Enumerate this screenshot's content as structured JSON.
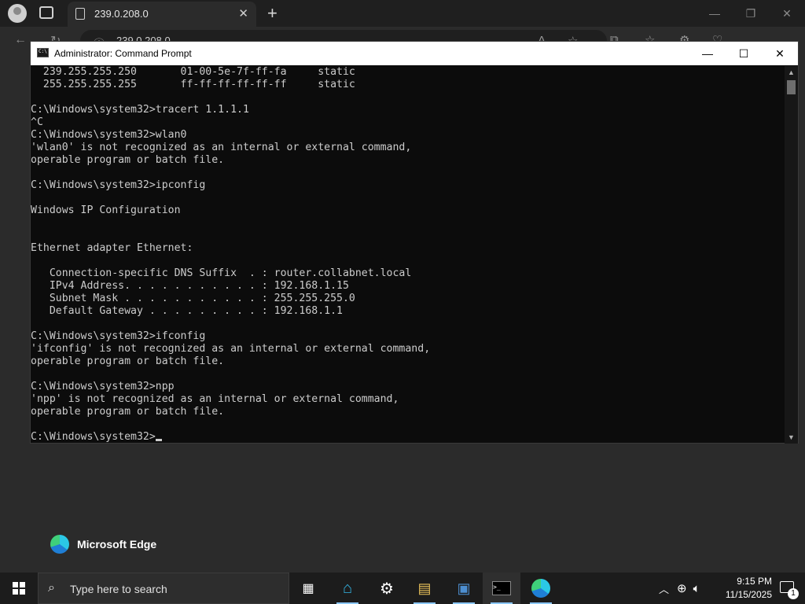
{
  "browser": {
    "tab_title": "239.0.208.0",
    "address": "239.0.208.0",
    "brand_text": "Microsoft Edge"
  },
  "cmd": {
    "title": "Administrator: Command Prompt",
    "lines": [
      "  239.255.255.250       01-00-5e-7f-ff-fa     static",
      "  255.255.255.255       ff-ff-ff-ff-ff-ff     static",
      "",
      "C:\\Windows\\system32>tracert 1.1.1.1",
      "^C",
      "C:\\Windows\\system32>wlan0",
      "'wlan0' is not recognized as an internal or external command,",
      "operable program or batch file.",
      "",
      "C:\\Windows\\system32>ipconfig",
      "",
      "Windows IP Configuration",
      "",
      "",
      "Ethernet adapter Ethernet:",
      "",
      "   Connection-specific DNS Suffix  . : router.collabnet.local",
      "   IPv4 Address. . . . . . . . . . . : 192.168.1.15",
      "   Subnet Mask . . . . . . . . . . . : 255.255.255.0",
      "   Default Gateway . . . . . . . . . : 192.168.1.1",
      "",
      "C:\\Windows\\system32>ifconfig",
      "'ifconfig' is not recognized as an internal or external command,",
      "operable program or batch file.",
      "",
      "C:\\Windows\\system32>npp",
      "'npp' is not recognized as an internal or external command,",
      "operable program or batch file.",
      "",
      "C:\\Windows\\system32>"
    ]
  },
  "taskbar": {
    "search_placeholder": "Type here to search",
    "time": "9:15 PM",
    "date": "11/15/2025",
    "notification_count": "1",
    "icons": [
      "task-view-icon",
      "app-icon",
      "settings-icon",
      "file-icon",
      "python-icon",
      "terminal-icon",
      "edge-icon"
    ]
  },
  "colors": {
    "console_bg": "#0c0c0c",
    "console_text": "#cccccc",
    "taskbar_bg": "#1c1c1c",
    "accent": "#8cc8ff"
  }
}
